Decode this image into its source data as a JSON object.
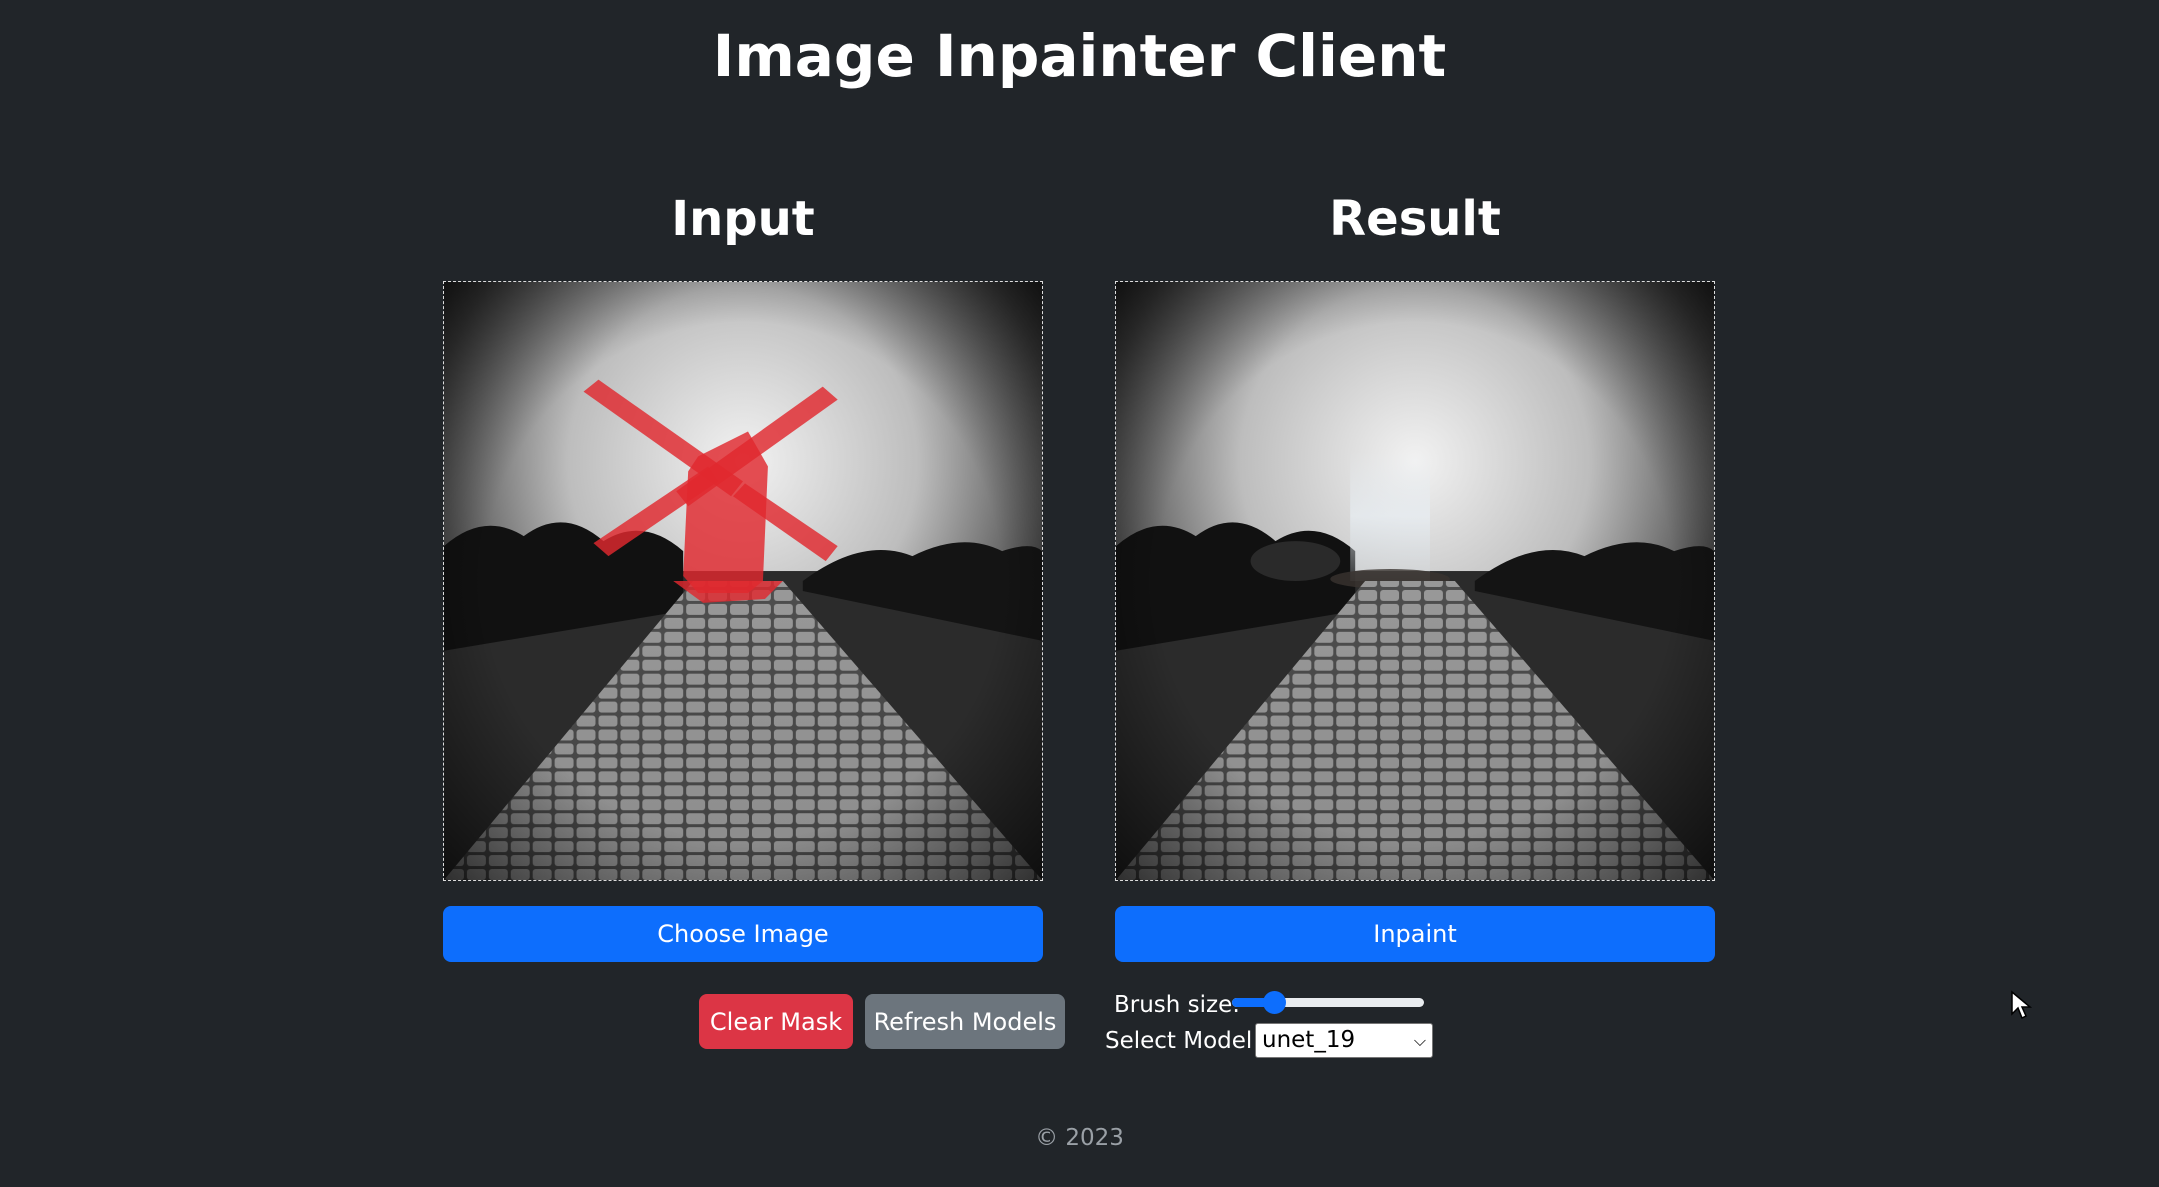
{
  "app": {
    "title": "Image Inpainter Client"
  },
  "input_panel": {
    "heading": "Input",
    "choose_button": "Choose Image"
  },
  "result_panel": {
    "heading": "Result",
    "inpaint_button": "Inpaint"
  },
  "controls": {
    "clear_mask_button": "Clear Mask",
    "refresh_models_button": "Refresh Models",
    "brush_size_label": "Brush size:",
    "brush_size_fraction": 0.22,
    "select_model_label": "Select Model:",
    "selected_model": "unet_19"
  },
  "footer": {
    "text": "© 2023"
  },
  "colors": {
    "background": "#212529",
    "primary": "#0d6efd",
    "danger": "#dc3545",
    "secondary": "#6c757d",
    "mask": "#e0282e"
  },
  "icons": {
    "select_arrow": "chevron-down-icon",
    "cursor": "mouse-pointer-icon"
  }
}
